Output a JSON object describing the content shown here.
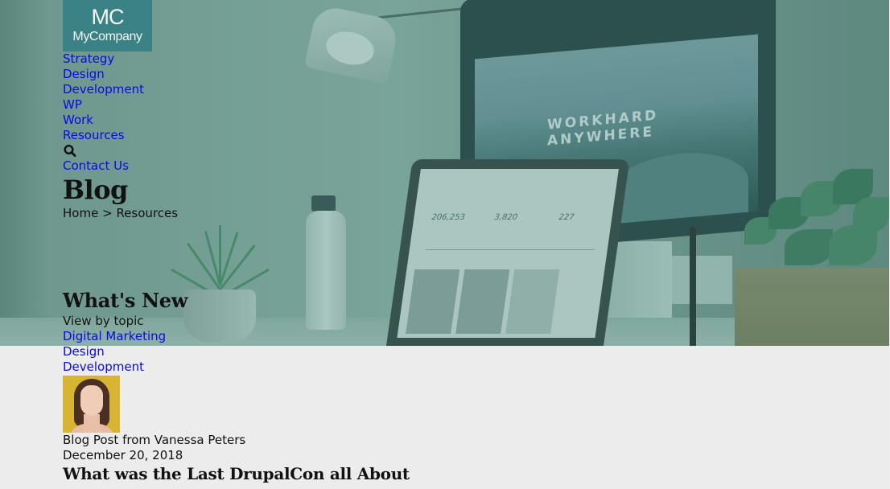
{
  "logo": {
    "initials": "MC",
    "name": "MyCompany"
  },
  "nav": {
    "items": [
      {
        "label": "Strategy"
      },
      {
        "label": "Design"
      },
      {
        "label": "Development"
      },
      {
        "label": "WP"
      },
      {
        "label": "Work"
      },
      {
        "label": "Resources"
      }
    ],
    "search_icon": "search-icon",
    "contact_label": "Contact Us"
  },
  "hero": {
    "title": "Blog",
    "breadcrumb": {
      "home": "Home",
      "separator": ">",
      "current": "Resources"
    },
    "image_text": {
      "line1": "WORKHARD",
      "line2": "ANYWHERE",
      "stat1": "206,253",
      "stat2": "3,820",
      "stat3": "227"
    }
  },
  "whats_new": {
    "title": "What's New",
    "topic_label": "View by topic",
    "topics": [
      {
        "label": "Digital Marketing"
      },
      {
        "label": "Design"
      },
      {
        "label": "Development"
      }
    ]
  },
  "post": {
    "byline": "Blog Post from Vanessa Peters",
    "date": "December 20, 2018",
    "title": "What was the Last DrupalCon all About"
  },
  "colors": {
    "link": "#0a0ae6",
    "logo_bg": "#3a8285",
    "page_bg": "#ececec",
    "hero_overlay": "#7fa59b"
  }
}
